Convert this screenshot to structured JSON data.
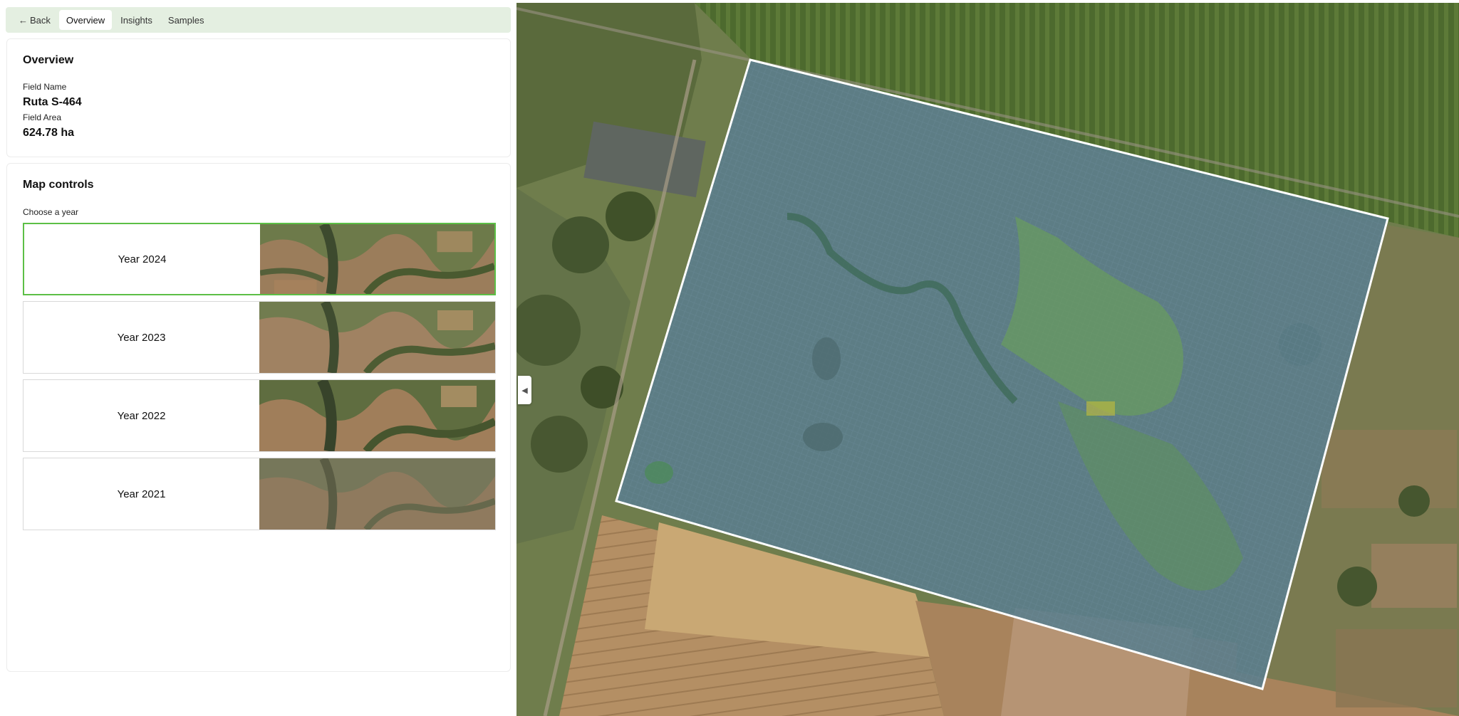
{
  "nav": {
    "back_label": "Back",
    "tabs": [
      {
        "label": "Overview",
        "active": true
      },
      {
        "label": "Insights",
        "active": false
      },
      {
        "label": "Samples",
        "active": false
      }
    ]
  },
  "overview": {
    "title": "Overview",
    "field_name_label": "Field Name",
    "field_name": "Ruta S-464",
    "field_area_label": "Field Area",
    "field_area": "624.78 ha"
  },
  "map_controls": {
    "title": "Map controls",
    "choose_label": "Choose a year",
    "years": [
      {
        "label": "Year 2024",
        "selected": true
      },
      {
        "label": "Year 2023",
        "selected": false
      },
      {
        "label": "Year 2022",
        "selected": false
      },
      {
        "label": "Year 2021",
        "selected": false
      }
    ]
  },
  "colors": {
    "accent": "#5cbf46",
    "nav_bg": "#e4efe1",
    "field_overlay": "#5b7d8c",
    "field_border": "#ffffff"
  },
  "icons": {
    "back": "arrow-left-icon",
    "collapse": "chevron-left-icon"
  }
}
